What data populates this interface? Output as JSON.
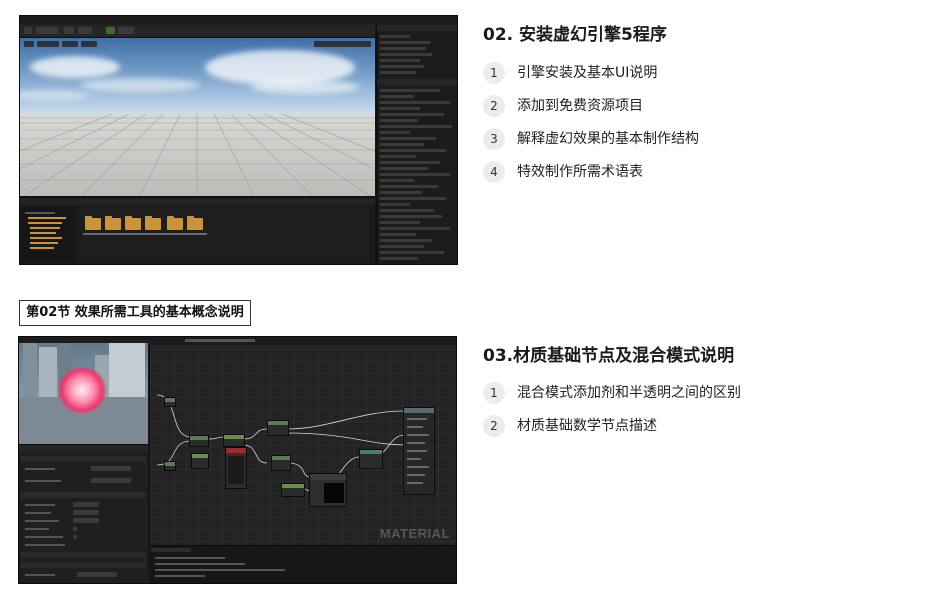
{
  "section1": {
    "title": "02. 安装虚幻引擎5程序",
    "items": [
      {
        "num": "1",
        "text": "引擎安装及基本UI说明"
      },
      {
        "num": "2",
        "text": "添加到免费资源项目"
      },
      {
        "num": "3",
        "text": "解释虚幻效果的基本制作结构"
      },
      {
        "num": "4",
        "text": "特效制作所需术语表"
      }
    ]
  },
  "chapter_label": "第02节 效果所需工具的基本概念说明",
  "section2": {
    "title": "03.材质基础节点及混合模式说明",
    "items": [
      {
        "num": "1",
        "text": "混合模式添加剂和半透明之间的区别"
      },
      {
        "num": "2",
        "text": "材质基础数学节点描述"
      }
    ]
  },
  "screenshot2": {
    "watermark": "MATERIAL"
  },
  "colors": {
    "folder": "#c9943b",
    "editor_bg": "#151515",
    "badge_bg": "#ececec"
  }
}
